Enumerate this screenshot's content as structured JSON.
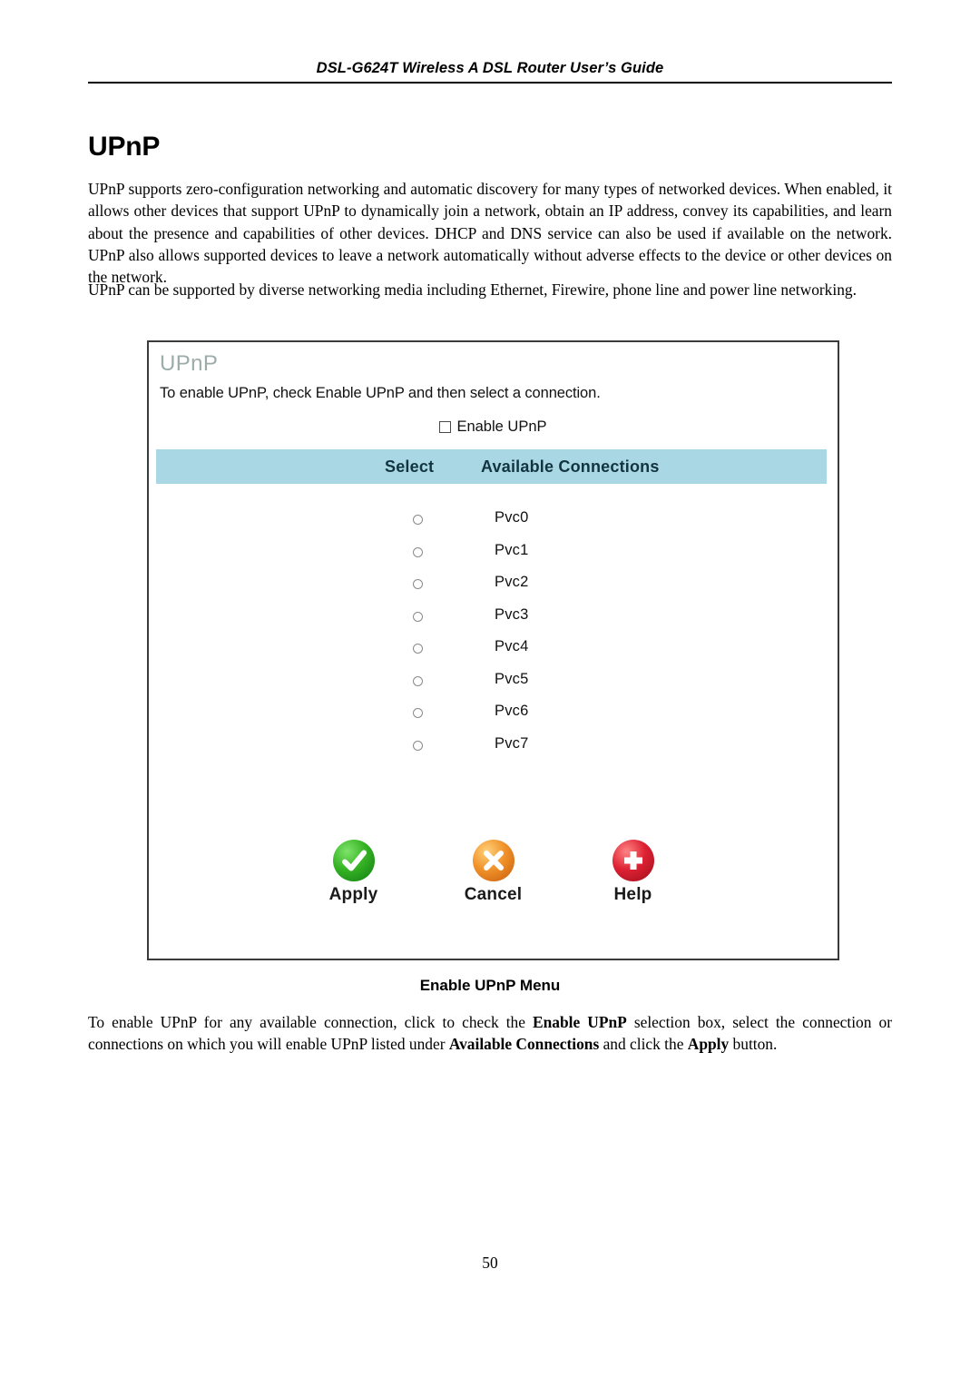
{
  "header": {
    "running_title": "DSL-G624T Wireless A DSL Router User’s Guide"
  },
  "page_heading": "UPnP",
  "paragraphs": {
    "intro": "UPnP supports zero-configuration networking and automatic discovery for many types of networked devices. When enabled, it allows other devices that support UPnP to dynamically join a network, obtain an IP address, convey its capabilities, and learn about the presence and capabilities of other devices. DHCP and DNS service can also be used if available on the network. UPnP also allows supported devices to leave a network automatically without adverse effects to the device or other devices on the network.",
    "media": "UPnP can be supported by diverse networking media including Ethernet, Firewire, phone line and power line networking."
  },
  "ui_panel": {
    "title": "UPnP",
    "instruction": "To enable UPnP, check Enable UPnP and then select a connection.",
    "enable_checkbox": {
      "label": "Enable UPnP",
      "checked": false
    },
    "table": {
      "columns": [
        "Select",
        "Available Connections"
      ],
      "rows": [
        {
          "name": "Pvc0",
          "selected": false
        },
        {
          "name": "Pvc1",
          "selected": false
        },
        {
          "name": "Pvc2",
          "selected": false
        },
        {
          "name": "Pvc3",
          "selected": false
        },
        {
          "name": "Pvc4",
          "selected": false
        },
        {
          "name": "Pvc5",
          "selected": false
        },
        {
          "name": "Pvc6",
          "selected": false
        },
        {
          "name": "Pvc7",
          "selected": false
        }
      ]
    },
    "buttons": [
      {
        "label": "Apply",
        "icon": "check-circle-icon",
        "color": "#36b324"
      },
      {
        "label": "Cancel",
        "icon": "cross-circle-icon",
        "color": "#f0922a"
      },
      {
        "label": "Help",
        "icon": "plus-circle-icon",
        "color": "#dd2233"
      }
    ],
    "colors": {
      "title": "#9cada9",
      "table_header_bg": "#aad7e4",
      "border": "#3a3a3a"
    }
  },
  "figure_caption": "Enable UPnP Menu",
  "closing_paragraph": {
    "part1": "To enable UPnP for any available connection, click to check the ",
    "bold1": "Enable UPnP",
    "part2": " selection box, select the connection or connections on which you will enable UPnP listed under ",
    "bold2": "Available Connections",
    "part3": " and click the ",
    "bold3": "Apply",
    "part4": " button."
  },
  "page_number": "50"
}
